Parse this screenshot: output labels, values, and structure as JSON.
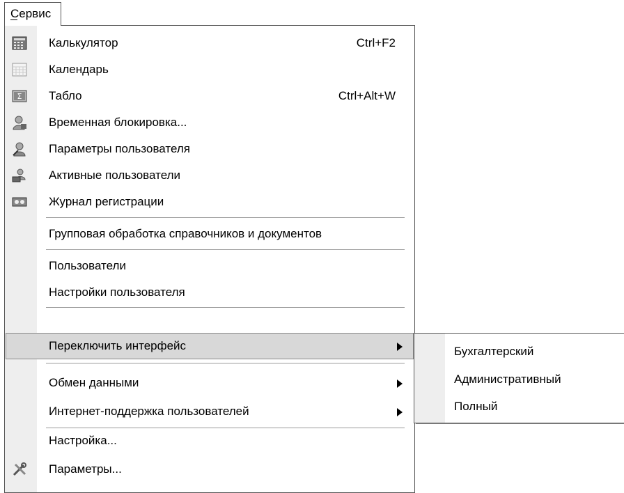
{
  "menubar": {
    "item_label": "Сервис"
  },
  "menu": {
    "items": [
      {
        "label": "Калькулятор",
        "shortcut": "Ctrl+F2",
        "icon": "calculator-icon"
      },
      {
        "label": "Календарь",
        "shortcut": "",
        "icon": "calendar-icon"
      },
      {
        "label": "Табло",
        "shortcut": "Ctrl+Alt+W",
        "icon": "scoreboard-icon"
      },
      {
        "label": "Временная блокировка...",
        "shortcut": "",
        "icon": "user-lock-icon"
      },
      {
        "label": "Параметры пользователя",
        "shortcut": "",
        "icon": "user-settings-icon"
      },
      {
        "label": "Активные пользователи",
        "shortcut": "",
        "icon": "active-users-icon"
      },
      {
        "label": "Журнал регистрации",
        "shortcut": "",
        "icon": "log-icon"
      },
      {
        "label": "Групповая обработка справочников и документов"
      },
      {
        "label": "Пользователи"
      },
      {
        "label": "Настройки пользователя"
      },
      {
        "label": "Переключить интерфейс",
        "submenu": true
      },
      {
        "label": "Обмен данными",
        "submenu": true
      },
      {
        "label": "Интернет-поддержка пользователей",
        "submenu": true
      },
      {
        "label": "Настройка..."
      },
      {
        "label": "Параметры...",
        "icon": "tools-icon"
      }
    ]
  },
  "submenu": {
    "items": [
      {
        "label": "Бухгалтерский"
      },
      {
        "label": "Административный"
      },
      {
        "label": "Полный"
      }
    ]
  }
}
